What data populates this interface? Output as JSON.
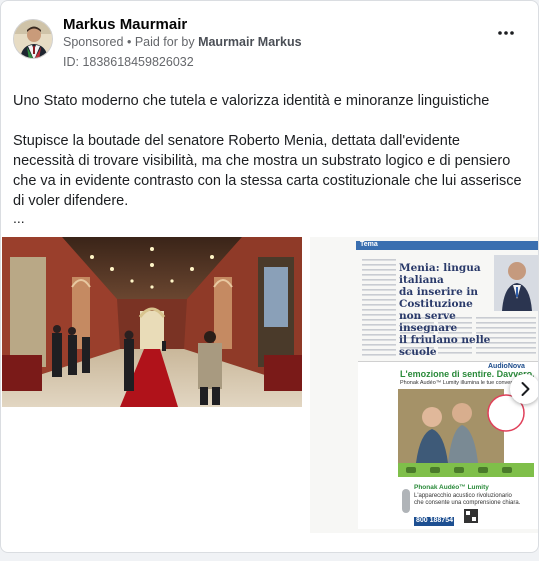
{
  "post": {
    "author": "Markus Maurmair",
    "sponsored_label": "Sponsored",
    "paid_for_prefix": "Paid for by",
    "payer": "Maurmair Markus",
    "ad_id": "ID: 1838618459826032",
    "body_paragraph_1": "Uno Stato moderno che tutela e valorizza identità e minoranze linguistiche",
    "body_paragraph_2": "Stupisce la boutade del senatore Roberto Menia, dettata dall'evidente necessità di trovare visibilità, ma che mostra un substrato logico e di pensiero che va in evidente contrasto con la stessa carta costituzionale che lui asserisce di voler difendere.",
    "truncation": "..."
  },
  "icons": {
    "more": "more-options-icon",
    "next": "chevron-right-icon"
  },
  "newspaper": {
    "section": "Tema",
    "headline_line_1": "Menia: lingua italiana",
    "headline_line_2": "da inserire in Costituzione",
    "headline_line_3": "non serve insegnare",
    "headline_line_4": "il friulano nelle scuole",
    "ad_brand": "AudioNova",
    "ad_slogan": "L'emozione di sentire. Davvero.",
    "ad_subline": "Phonak Audéo™ Lumity illumina le tue conversazioni",
    "ad_product": "Phonak Audéo™ Lumity",
    "ad_product_desc_1": "L'apparecchio acustico rivoluzionario",
    "ad_product_desc_2": "che consente una comprensione chiara.",
    "ad_phone": "800 188754"
  },
  "colors": {
    "background": "#f0f2f5",
    "card": "#ffffff",
    "secondary_text": "#65676b"
  }
}
